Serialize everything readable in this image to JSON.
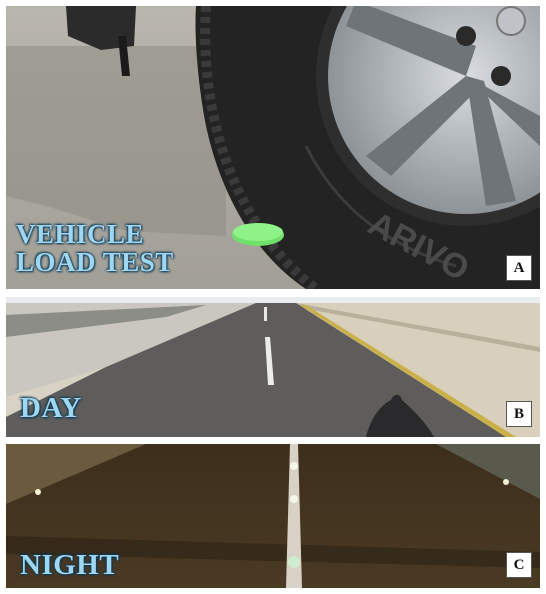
{
  "panels": [
    {
      "id": "A",
      "caption_lines": [
        "VEHICLE",
        "LOAD TEST"
      ],
      "letter": "A"
    },
    {
      "id": "B",
      "caption_lines": [
        "DAY"
      ],
      "letter": "B"
    },
    {
      "id": "C",
      "caption_lines": [
        "NIGHT"
      ],
      "letter": "C"
    }
  ],
  "caption_color": "#9fd6f2",
  "tire_brand": "ARIVO"
}
